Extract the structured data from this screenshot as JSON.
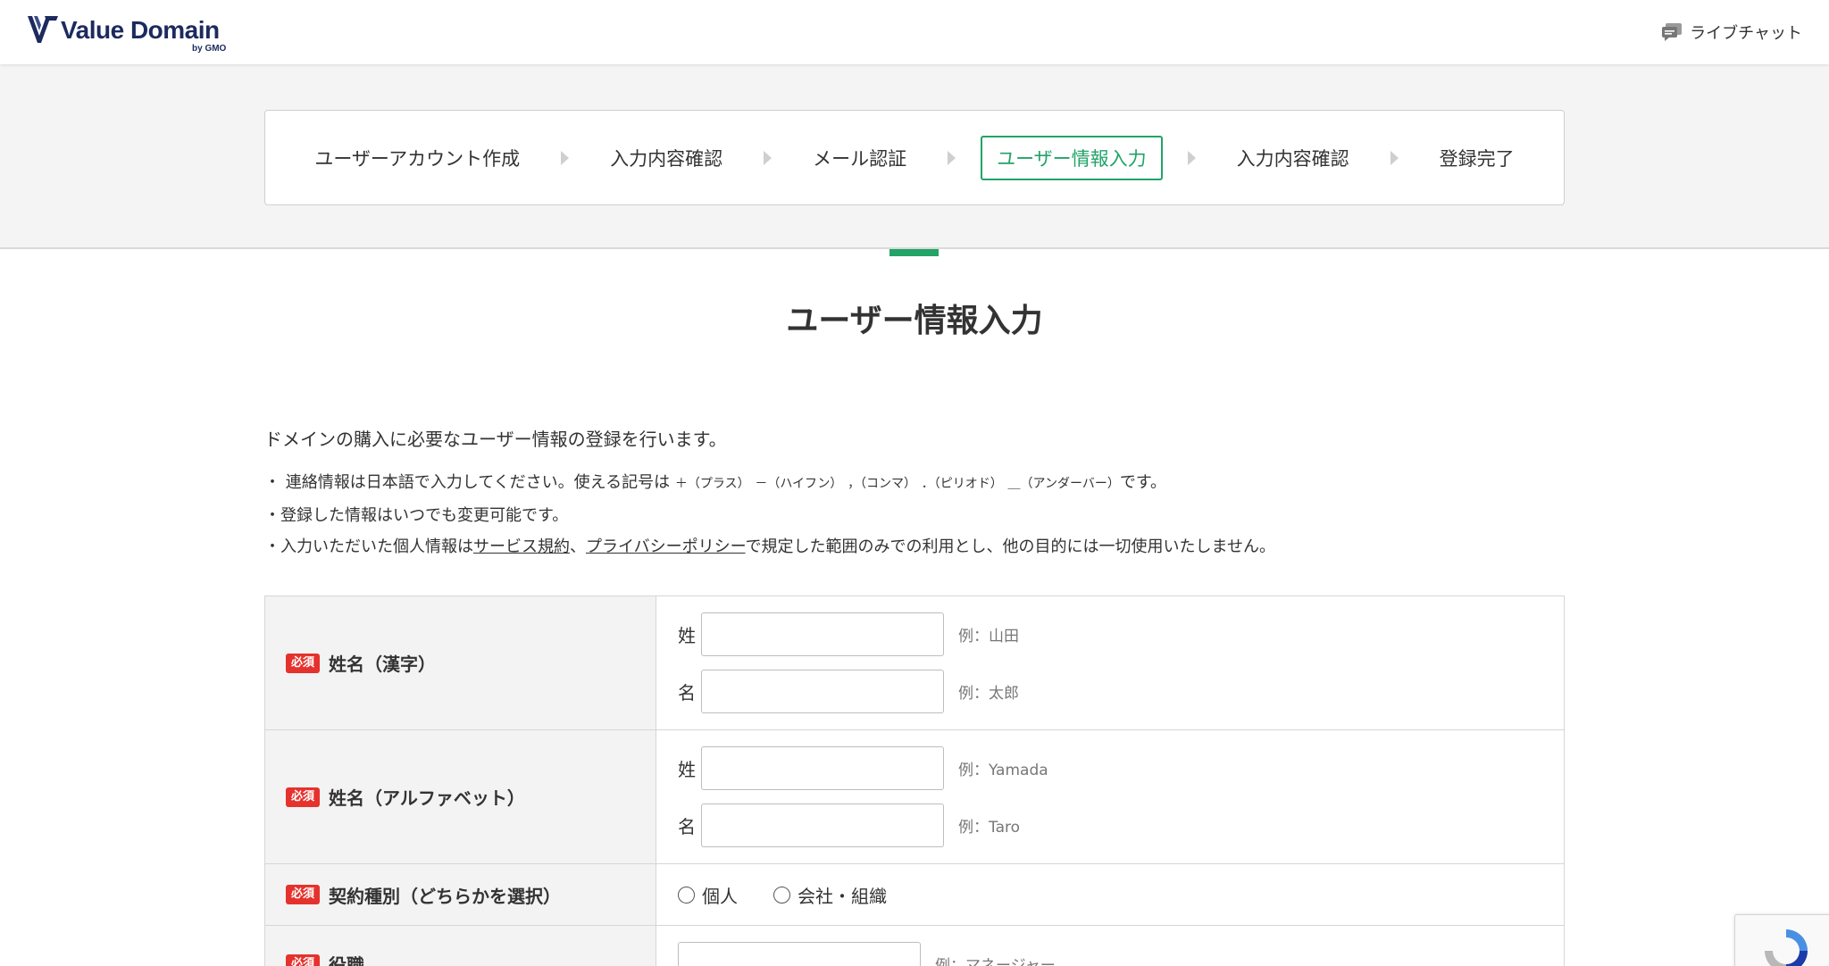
{
  "header": {
    "brand": "Value Domain",
    "brand_sub": "by GMO",
    "chat_label": "ライブチャット"
  },
  "steps": [
    {
      "label": "ユーザーアカウント作成",
      "active": false
    },
    {
      "label": "入力内容確認",
      "active": false
    },
    {
      "label": "メール認証",
      "active": false
    },
    {
      "label": "ユーザー情報入力",
      "active": true
    },
    {
      "label": "入力内容確認",
      "active": false
    },
    {
      "label": "登録完了",
      "active": false
    }
  ],
  "page_title": "ユーザー情報入力",
  "intro": "ドメインの購入に必要なユーザー情報の登録を行います。",
  "notes": {
    "symbols": {
      "prefix": "連絡情報は日本語で入力してください。使える記号は",
      "plus": "＋（プラス）",
      "hyphen": "－（ハイフン）",
      "comma": "，（コンマ）",
      "period": "．（ピリオド）",
      "underscore": "＿（アンダーバー）",
      "suffix": "です。"
    },
    "changeable": "登録した情報はいつでも変更可能です。",
    "privacy": {
      "prefix": "入力いただいた個人情報は",
      "terms_link": "サービス規約",
      "separator": "、",
      "privacy_link": "プライバシーポリシー",
      "suffix": "で規定した範囲のみでの利用とし、他の目的には一切使用いたしません。"
    }
  },
  "form": {
    "required_badge": "必須",
    "name_kanji": {
      "label": "姓名（漢字）",
      "last_key": "姓",
      "last_value": "",
      "last_example": "例：山田",
      "first_key": "名",
      "first_value": "",
      "first_example": "例：太郎"
    },
    "name_alpha": {
      "label": "姓名（アルファベット）",
      "last_key": "姓",
      "last_value": "",
      "last_example": "例：Yamada",
      "first_key": "名",
      "first_value": "",
      "first_example": "例：Taro"
    },
    "contract_type": {
      "label": "契約種別（どちらかを選択）",
      "options": [
        "個人",
        "会社・組織"
      ]
    },
    "position": {
      "label": "役職",
      "value": "",
      "example": "例：マネージャー"
    }
  },
  "colors": {
    "accent": "#22a368",
    "required": "#e5322d",
    "brand": "#1c2a5e"
  },
  "icons": {
    "chat": "chat-bubble-icon",
    "recaptcha": "recaptcha-icon"
  }
}
